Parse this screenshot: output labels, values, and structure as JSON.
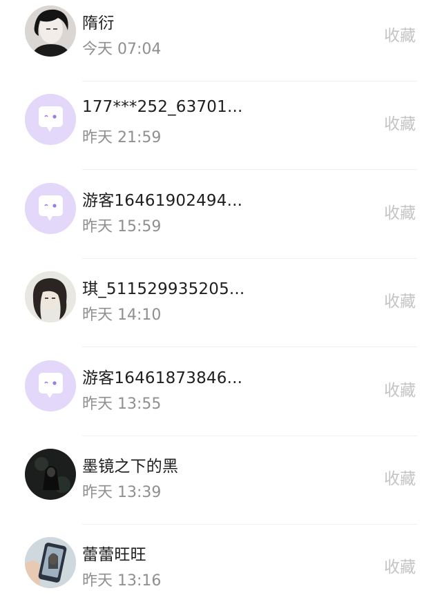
{
  "list": {
    "items": [
      {
        "name": "隋衍",
        "time": "今天 07:04",
        "action": "收藏",
        "avatar": "photo-dark-hair-man"
      },
      {
        "name": "177***252_63701...",
        "time": "昨天 21:59",
        "action": "收藏",
        "avatar": "default-chat-bubble"
      },
      {
        "name": "游客16461902494...",
        "time": "昨天 15:59",
        "action": "收藏",
        "avatar": "default-chat-bubble"
      },
      {
        "name": "琪_511529935205...",
        "time": "昨天 14:10",
        "action": "收藏",
        "avatar": "photo-girl-long-hair"
      },
      {
        "name": "游客16461873846...",
        "time": "昨天 13:55",
        "action": "收藏",
        "avatar": "default-chat-bubble"
      },
      {
        "name": "墨镜之下的黑",
        "time": "昨天 13:39",
        "action": "收藏",
        "avatar": "photo-dark-figure"
      },
      {
        "name": "蕾蕾旺旺",
        "time": "昨天 13:16",
        "action": "收藏",
        "avatar": "photo-phone-selfie"
      }
    ]
  },
  "colors": {
    "default_avatar_bg": "#e4d8fa",
    "default_avatar_icon": "#ffffff",
    "default_avatar_dot": "#9a7ce6"
  }
}
